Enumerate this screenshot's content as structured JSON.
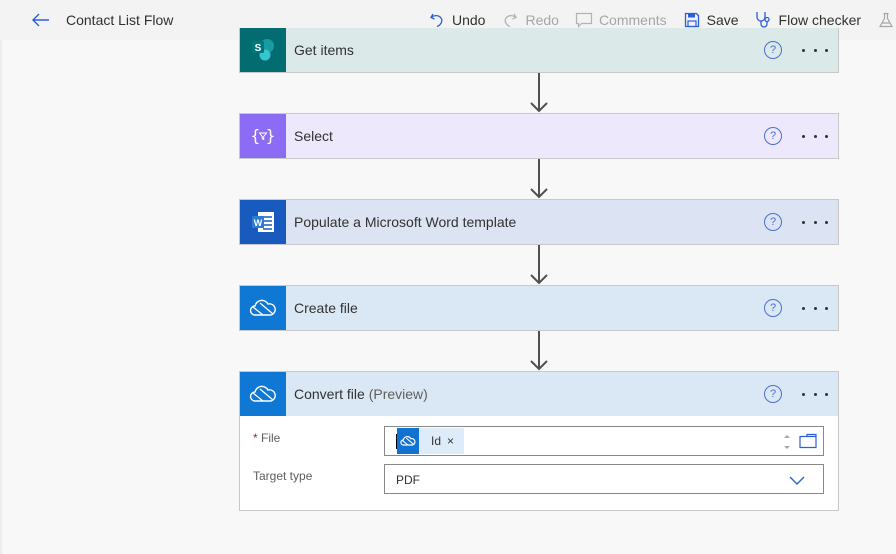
{
  "header": {
    "back_icon": "arrow-left-icon",
    "title": "Contact List Flow"
  },
  "toolbar": {
    "undo": {
      "label": "Undo",
      "icon": "undo-icon",
      "enabled": true
    },
    "redo": {
      "label": "Redo",
      "icon": "redo-icon",
      "enabled": false
    },
    "comments": {
      "label": "Comments",
      "icon": "comment-icon",
      "enabled": false
    },
    "save": {
      "label": "Save",
      "icon": "save-icon",
      "enabled": true
    },
    "flow_checker": {
      "label": "Flow checker",
      "icon": "stethoscope-icon",
      "enabled": true
    },
    "test": {
      "icon": "flask-icon"
    }
  },
  "steps": [
    {
      "title": "Get items",
      "icon": "sharepoint-icon",
      "icon_bg": "#036c70",
      "head_bg": "#dbe9e9"
    },
    {
      "title": "Select",
      "icon": "data-operation-icon",
      "icon_bg": "#8c6cf5",
      "head_bg": "#ede8fc"
    },
    {
      "title": "Populate a Microsoft Word template",
      "icon": "word-icon",
      "icon_bg": "#185abd",
      "head_bg": "#dce4f4"
    },
    {
      "title": "Create file",
      "icon": "onedrive-icon",
      "icon_bg": "#0f78d4",
      "head_bg": "#dae8f6"
    },
    {
      "title": "Convert file",
      "title_suffix": "(Preview)",
      "icon": "onedrive-icon",
      "icon_bg": "#0f78d4",
      "head_bg": "#dae8f6"
    }
  ],
  "step_actions": {
    "help": "?",
    "help_icon": "help-icon",
    "more_icon": "more-icon"
  },
  "convert_form": {
    "file": {
      "required_mark": "*",
      "label": "File",
      "token_label": "Id",
      "token_icon": "onedrive-icon",
      "token_remove": "×"
    },
    "target_type": {
      "label": "Target type",
      "value": "PDF"
    }
  },
  "colors": {
    "accent": "#2b5fd9",
    "topbar_bg": "#f3f3f3",
    "canvas_bg": "#f8f8f8"
  }
}
